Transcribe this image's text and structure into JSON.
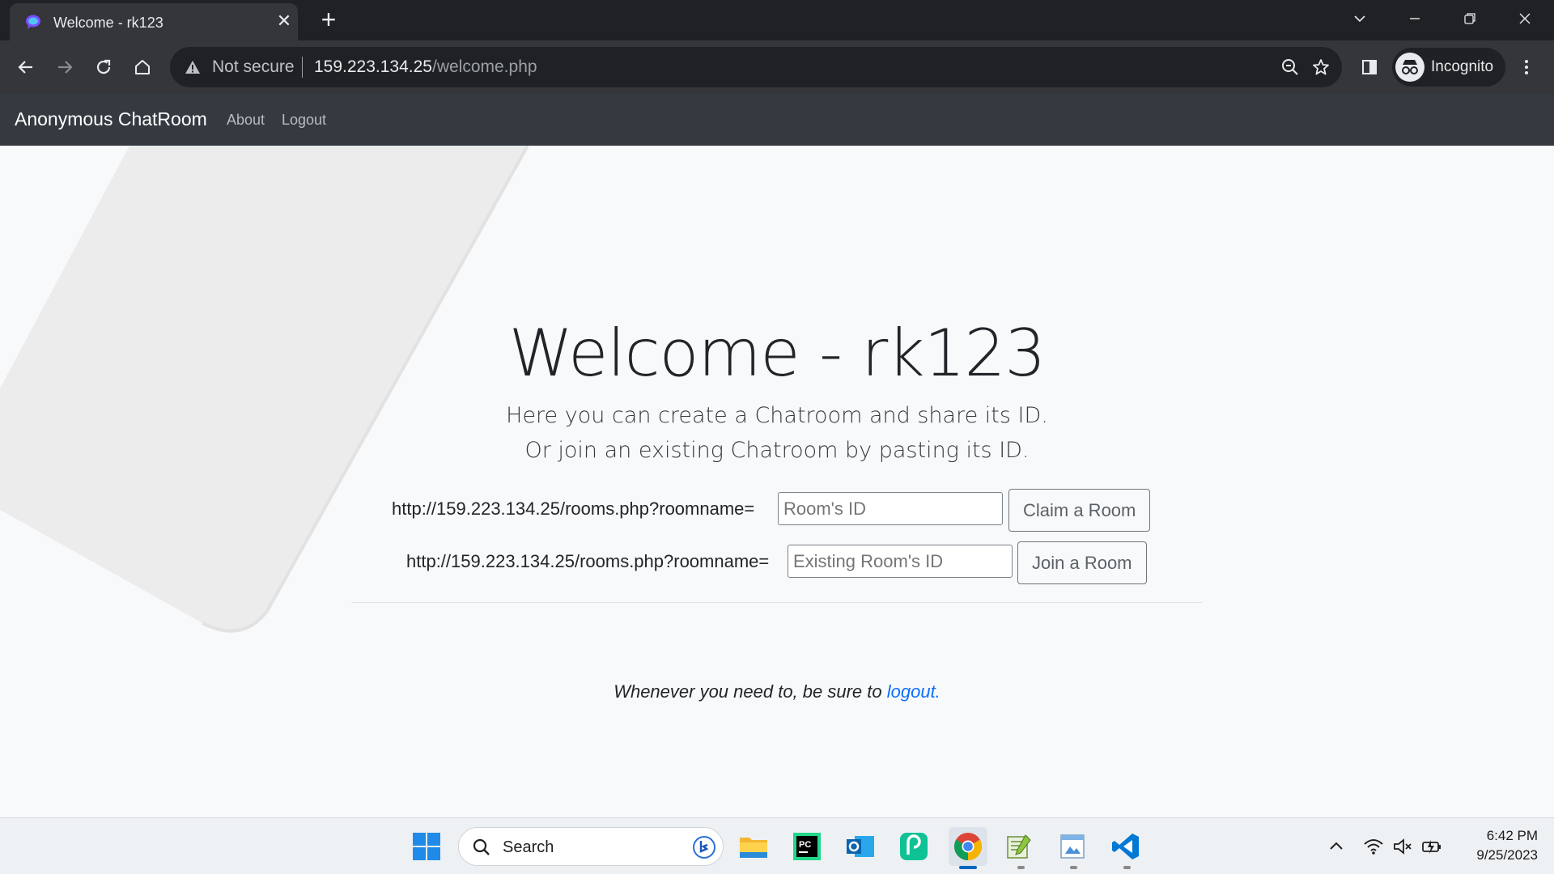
{
  "browser": {
    "tab_title": "Welcome - rk123",
    "security_label": "Not secure",
    "url_host": "159.223.134.25",
    "url_path": "/welcome.php",
    "profile_label": "Incognito"
  },
  "navbar": {
    "brand": "Anonymous ChatRoom",
    "links": [
      "About",
      "Logout"
    ]
  },
  "main": {
    "title": "Welcome - rk123",
    "lead_lines": [
      "Here you can create a Chatroom and share its ID.",
      "Or join an existing Chatroom by pasting its ID."
    ],
    "claim_row": {
      "prefix": "http://159.223.134.25/rooms.php?roomname=",
      "placeholder": "Room's ID",
      "button": "Claim a Room"
    },
    "join_row": {
      "prefix": "http://159.223.134.25/rooms.php?roomname=",
      "placeholder": "Existing Room's ID",
      "button": "Join a Room"
    },
    "footer_text": "Whenever you need to, be sure to ",
    "footer_link": "logout."
  },
  "taskbar": {
    "search_placeholder": "Search",
    "apps": [
      "start-icon",
      "file-explorer-icon",
      "pycharm-icon",
      "outlook-icon",
      "picsart-icon",
      "chrome-icon",
      "notepad-plus-plus-icon",
      "image-viewer-icon",
      "vscode-icon"
    ],
    "time": "6:42 PM",
    "date": "9/25/2023"
  },
  "colors": {
    "navbar_bg": "#343a40",
    "page_bg": "#f8f9fa",
    "link_blue": "#0d6efd",
    "chrome_dark": "#202124"
  }
}
